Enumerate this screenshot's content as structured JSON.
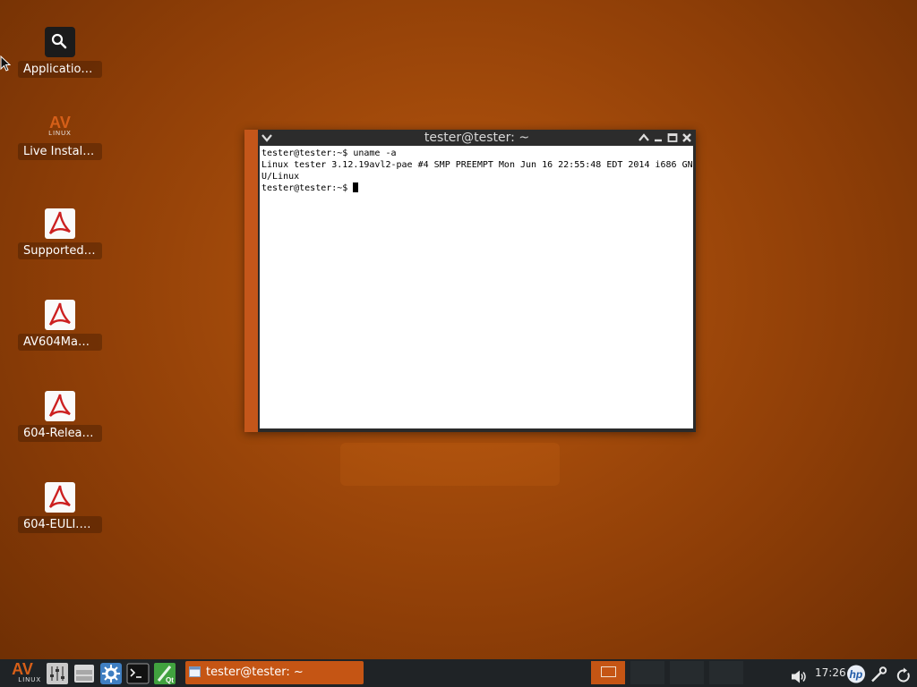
{
  "desktop": {
    "icons": [
      {
        "label": "Application ...",
        "icon": "search-icon"
      },
      {
        "label": "Live Installer",
        "icon": "avlinux-logo-icon"
      },
      {
        "label": "SupportedH...",
        "icon": "pdf-document-icon"
      },
      {
        "label": "AV604Manu...",
        "icon": "pdf-document-icon"
      },
      {
        "label": "604-Release...",
        "icon": "pdf-document-icon"
      },
      {
        "label": "604-EULI.pdf",
        "icon": "pdf-document-icon"
      }
    ],
    "logo_text": {
      "av": "AV",
      "linux": "LINUX"
    }
  },
  "terminal": {
    "title": "tester@tester: ~",
    "lines": [
      "tester@tester:~$ uname -a",
      "Linux tester 3.12.19avl2-pae #4 SMP PREEMPT Mon Jun 16 22:55:48 EDT 2014 i686 GN",
      "U/Linux",
      "tester@tester:~$ "
    ]
  },
  "taskbar": {
    "start_logo": {
      "av": "AV",
      "linux": "LINUX"
    },
    "launchers": [
      "mixer-icon",
      "file-manager-icon",
      "settings-icon",
      "terminal-icon",
      "qt-creator-icon"
    ],
    "task_label": "tester@tester: ~",
    "clock": "17:26",
    "tray": [
      "volume-icon",
      "hp-icon",
      "tool-icon",
      "power-icon"
    ],
    "colors": {
      "accent": "#c55514",
      "panel": "#1f2326"
    }
  }
}
